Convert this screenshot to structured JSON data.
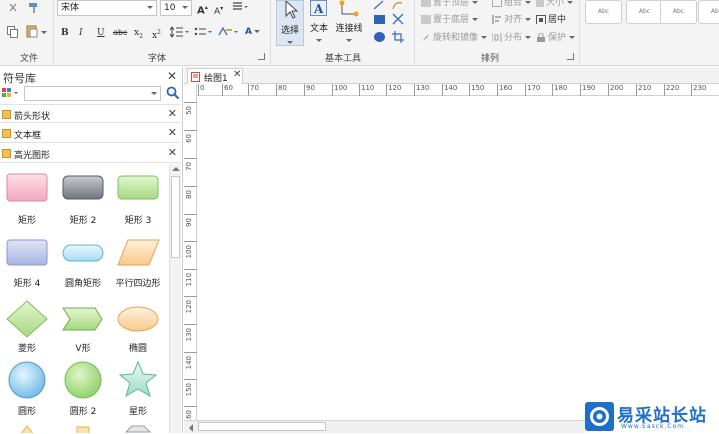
{
  "ribbon": {
    "font_group": {
      "font_name": "宋体",
      "font_size": "10",
      "label": "字体",
      "bold": "B",
      "italic": "I",
      "underline": "U",
      "strike": "abc",
      "subscript": "x",
      "superscript": "x"
    },
    "file_group": {
      "label": "文件"
    },
    "tools_group": {
      "label": "基本工具",
      "select": "选择",
      "text": "文本",
      "connector": "连接线"
    },
    "arrange_group": {
      "label": "排列",
      "bring_front": "置于顶层",
      "send_back": "置于底层",
      "rotate_flip": "旋转和镜像",
      "group": "组合",
      "align": "对齐",
      "distribute": "分布",
      "size": "大小",
      "center": "居中",
      "protect": "保护"
    },
    "styles": [
      "Abc",
      "Abc",
      "Abc",
      "Abc"
    ]
  },
  "symbol_panel": {
    "title": "符号库",
    "search_placeholder": "",
    "sections": [
      {
        "label": "箭头形状"
      },
      {
        "label": "文本框"
      },
      {
        "label": "高光图形"
      }
    ],
    "shapes": [
      {
        "label": "矩形",
        "icon": "pink-rect"
      },
      {
        "label": "矩形 2",
        "icon": "gray-rounded-rect"
      },
      {
        "label": "矩形 3",
        "icon": "green-rect"
      },
      {
        "label": "矩形 4",
        "icon": "blue-rect"
      },
      {
        "label": "圆角矩形",
        "icon": "pill"
      },
      {
        "label": "平行四边形",
        "icon": "parallelogram"
      },
      {
        "label": "菱形",
        "icon": "diamond"
      },
      {
        "label": "V形",
        "icon": "chevron"
      },
      {
        "label": "椭圆",
        "icon": "ellipse"
      },
      {
        "label": "圆形",
        "icon": "circle-blue"
      },
      {
        "label": "圆形 2",
        "icon": "circle-green"
      },
      {
        "label": "星形",
        "icon": "star"
      }
    ]
  },
  "canvas": {
    "tab_label": "绘图1",
    "h_ruler_ticks": [
      "0",
      "60",
      "70",
      "80",
      "90",
      "100",
      "110",
      "120",
      "130",
      "140",
      "150",
      "160",
      "170",
      "180",
      "190",
      "200",
      "210",
      "220",
      "230"
    ],
    "v_ruler_ticks": [
      "50",
      "60",
      "70",
      "80",
      "90",
      "100",
      "110",
      "120",
      "130",
      "140",
      "150",
      "160"
    ]
  },
  "watermark": {
    "brand": "易采站长站",
    "url": "Www.Easck.Com"
  }
}
